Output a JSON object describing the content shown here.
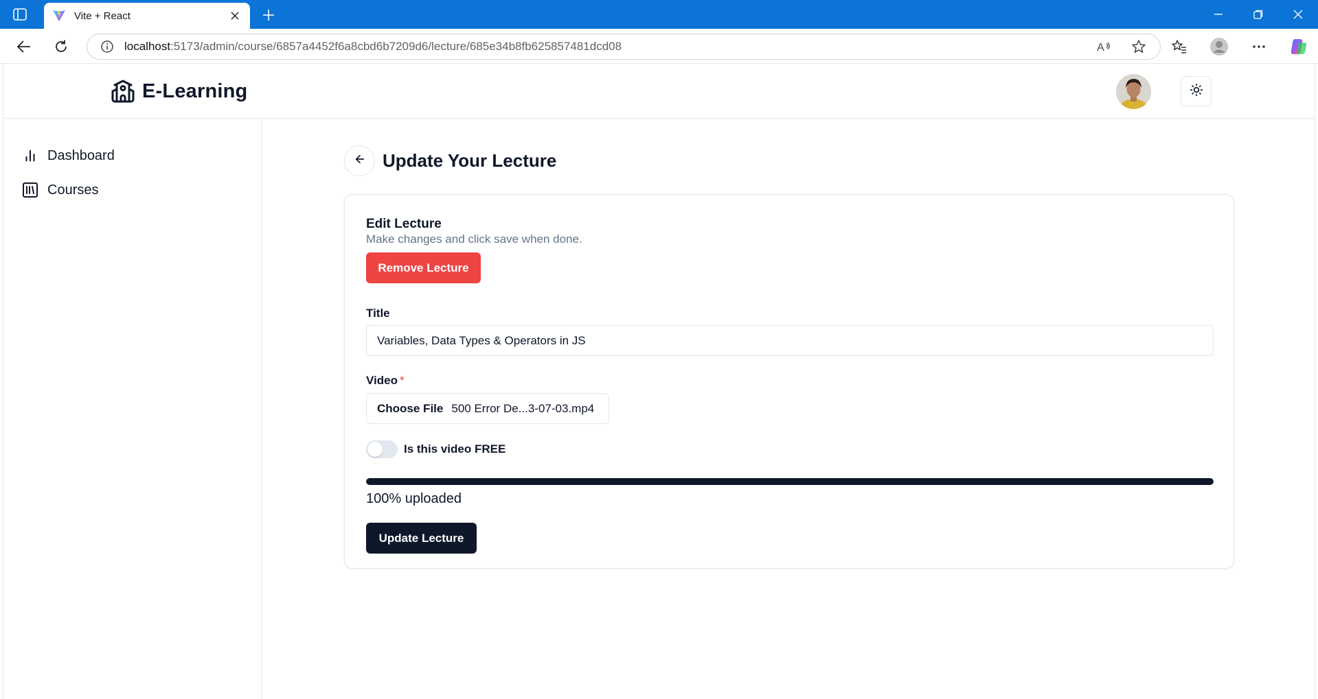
{
  "browser": {
    "tab_title": "Vite + React",
    "url_host": "localhost",
    "url_path": ":5173/admin/course/6857a4452f6a8cbd6b7209d6/lecture/685e34b8fb625857481dcd08"
  },
  "header": {
    "brand": "E-Learning"
  },
  "sidebar": {
    "items": [
      {
        "label": "Dashboard"
      },
      {
        "label": "Courses"
      }
    ]
  },
  "page": {
    "title": "Update Your Lecture"
  },
  "card": {
    "title": "Edit Lecture",
    "description": "Make changes and click save when done.",
    "remove_label": "Remove Lecture",
    "title_label": "Title",
    "title_value": "Variables, Data Types & Operators in JS",
    "video_label": "Video",
    "required_mark": "*",
    "choose_file_label": "Choose File",
    "file_name": "500 Error De...3-07-03.mp4",
    "free_label": "Is this video FREE",
    "free_checked": false,
    "upload_progress": 100,
    "progress_text": "100% uploaded",
    "update_label": "Update Lecture"
  },
  "colors": {
    "chrome_blue": "#0b74d6",
    "danger": "#ef4444",
    "primary": "#0f172a",
    "muted": "#64748b"
  }
}
